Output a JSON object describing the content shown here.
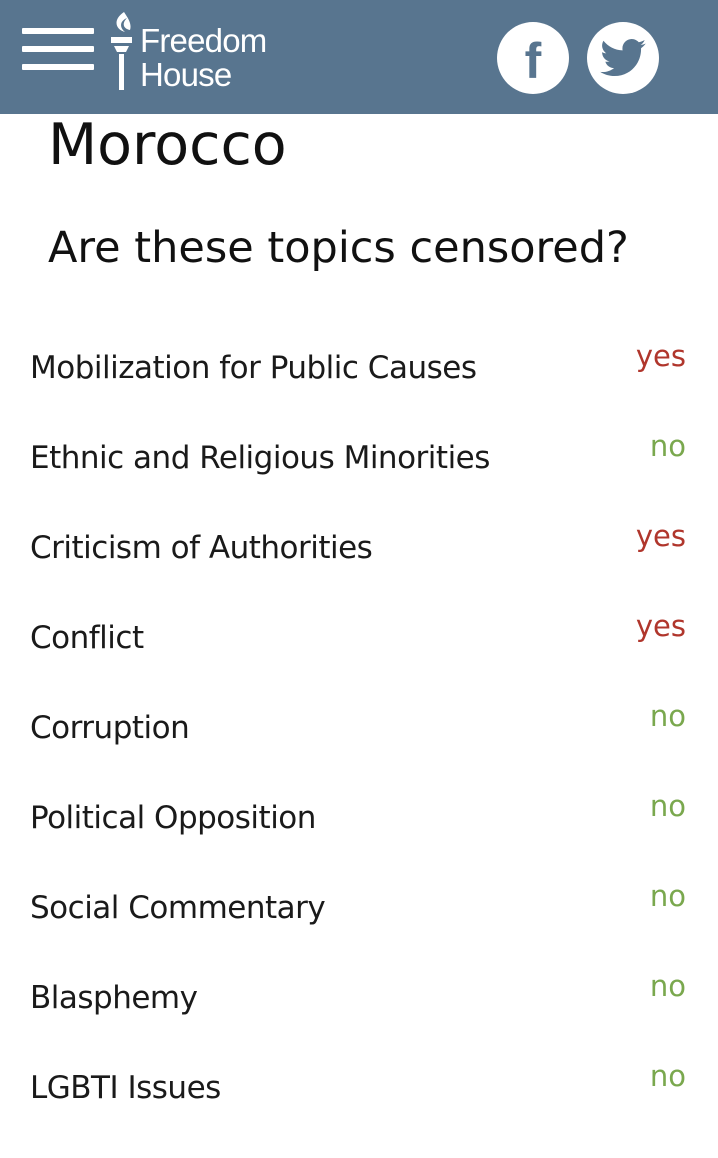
{
  "header": {
    "logo_line1": "Freedom",
    "logo_line2": "House",
    "menu_icon": "hamburger-menu-icon",
    "facebook_icon": "facebook-icon",
    "twitter_icon": "twitter-icon",
    "facebook_glyph": "f",
    "bar_color": "#58758f"
  },
  "page": {
    "country": "Morocco",
    "question": "Are these topics censored?"
  },
  "topics": [
    {
      "label": "Mobilization for Public Causes",
      "answer": "yes"
    },
    {
      "label": "Ethnic and Religious Minorities",
      "answer": "no"
    },
    {
      "label": "Criticism of Authorities",
      "answer": "yes"
    },
    {
      "label": "Conflict",
      "answer": "yes"
    },
    {
      "label": "Corruption",
      "answer": "no"
    },
    {
      "label": "Political Opposition",
      "answer": "no"
    },
    {
      "label": "Social Commentary",
      "answer": "no"
    },
    {
      "label": "Blasphemy",
      "answer": "no"
    },
    {
      "label": "LGBTI Issues",
      "answer": "no"
    }
  ],
  "colors": {
    "yes": "#b0362c",
    "no": "#7aa84e"
  }
}
